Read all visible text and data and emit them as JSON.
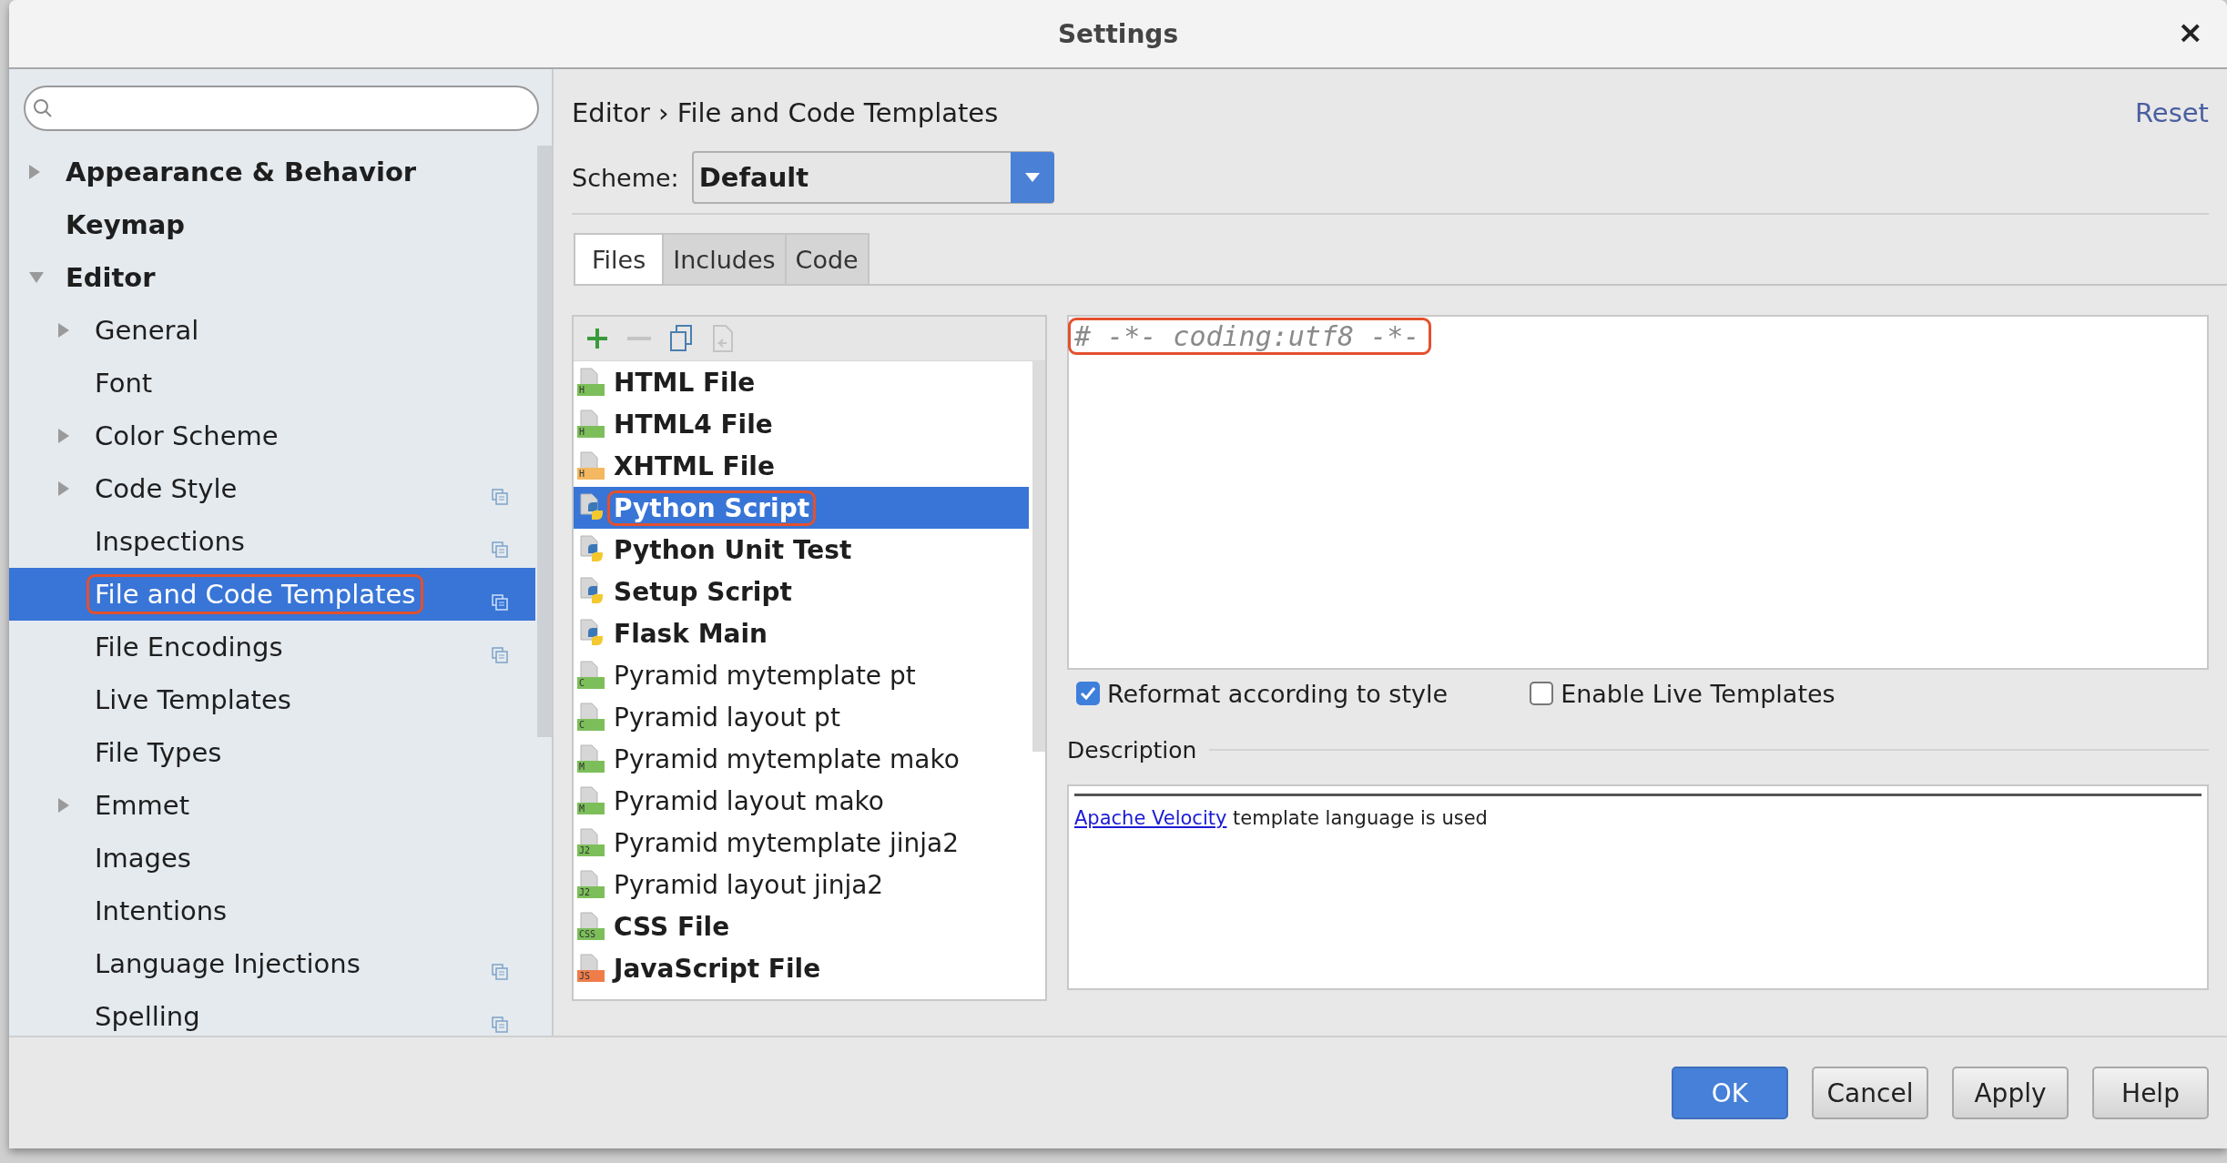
{
  "window": {
    "title": "Settings",
    "close": "×"
  },
  "sidebar": {
    "items": [
      {
        "label": "Appearance & Behavior",
        "expanded": false,
        "selected": false,
        "project_scoped": false,
        "annotated": false
      },
      {
        "label": "Keymap",
        "selected": false,
        "project_scoped": false,
        "annotated": false
      },
      {
        "label": "Editor",
        "expanded": true,
        "selected": false,
        "project_scoped": false,
        "annotated": false,
        "children": [
          {
            "label": "General",
            "expanded": false,
            "selected": false,
            "project_scoped": false,
            "annotated": false
          },
          {
            "label": "Font",
            "selected": false,
            "project_scoped": false,
            "annotated": false
          },
          {
            "label": "Color Scheme",
            "expanded": false,
            "selected": false,
            "project_scoped": false,
            "annotated": false
          },
          {
            "label": "Code Style",
            "expanded": false,
            "selected": false,
            "project_scoped": true,
            "annotated": false
          },
          {
            "label": "Inspections",
            "selected": false,
            "project_scoped": true,
            "annotated": false
          },
          {
            "label": "File and Code Templates",
            "selected": true,
            "project_scoped": true,
            "annotated": true
          },
          {
            "label": "File Encodings",
            "selected": false,
            "project_scoped": true,
            "annotated": false
          },
          {
            "label": "Live Templates",
            "selected": false,
            "project_scoped": false,
            "annotated": false
          },
          {
            "label": "File Types",
            "selected": false,
            "project_scoped": false,
            "annotated": false
          },
          {
            "label": "Emmet",
            "expanded": false,
            "selected": false,
            "project_scoped": false,
            "annotated": false
          },
          {
            "label": "Images",
            "selected": false,
            "project_scoped": false,
            "annotated": false
          },
          {
            "label": "Intentions",
            "selected": false,
            "project_scoped": false,
            "annotated": false
          },
          {
            "label": "Language Injections",
            "selected": false,
            "project_scoped": true,
            "annotated": false
          },
          {
            "label": "Spelling",
            "selected": false,
            "project_scoped": true,
            "annotated": false
          }
        ]
      }
    ]
  },
  "breadcrumb": "Editor › File and Code Templates",
  "reset_link": "Reset",
  "scheme": {
    "label": "Scheme:",
    "value": "Default"
  },
  "tabs": [
    {
      "label": "Files",
      "selected": true
    },
    {
      "label": "Includes",
      "selected": false
    },
    {
      "label": "Code",
      "selected": false
    }
  ],
  "toolbar": [
    {
      "kind": "add",
      "disabled": false
    },
    {
      "kind": "remove",
      "disabled": true
    },
    {
      "kind": "copy",
      "disabled": false
    },
    {
      "kind": "reset",
      "disabled": true
    }
  ],
  "templates": [
    {
      "name": "HTML File",
      "kind": "html",
      "badge": "H",
      "bold": true,
      "selected": false,
      "annotated": false
    },
    {
      "name": "HTML4 File",
      "kind": "html",
      "badge": "H",
      "bold": true,
      "selected": false,
      "annotated": false
    },
    {
      "name": "XHTML File",
      "kind": "xhtml",
      "badge": "H",
      "bold": true,
      "selected": false,
      "annotated": false
    },
    {
      "name": "Python Script",
      "kind": "python",
      "bold": true,
      "selected": true,
      "annotated": true
    },
    {
      "name": "Python Unit Test",
      "kind": "python",
      "bold": true,
      "selected": false,
      "annotated": false
    },
    {
      "name": "Setup Script",
      "kind": "python",
      "bold": true,
      "selected": false,
      "annotated": false
    },
    {
      "name": "Flask Main",
      "kind": "python",
      "bold": true,
      "selected": false,
      "annotated": false
    },
    {
      "name": "Pyramid mytemplate pt",
      "kind": "chameleon",
      "badge": "C",
      "bold": false,
      "selected": false,
      "annotated": false
    },
    {
      "name": "Pyramid layout pt",
      "kind": "chameleon",
      "badge": "C",
      "bold": false,
      "selected": false,
      "annotated": false
    },
    {
      "name": "Pyramid mytemplate mako",
      "kind": "mako",
      "badge": "M",
      "bold": false,
      "selected": false,
      "annotated": false
    },
    {
      "name": "Pyramid layout mako",
      "kind": "mako",
      "badge": "M",
      "bold": false,
      "selected": false,
      "annotated": false
    },
    {
      "name": "Pyramid mytemplate jinja2",
      "kind": "jinja2",
      "badge": "J2",
      "bold": false,
      "selected": false,
      "annotated": false
    },
    {
      "name": "Pyramid layout jinja2",
      "kind": "jinja2",
      "badge": "J2",
      "bold": false,
      "selected": false,
      "annotated": false
    },
    {
      "name": "CSS File",
      "kind": "css",
      "badge": "CSS",
      "bold": true,
      "selected": false,
      "annotated": false
    },
    {
      "name": "JavaScript File",
      "kind": "js",
      "badge": "JS",
      "bold": true,
      "selected": false,
      "annotated": false
    }
  ],
  "editor": {
    "text": "# -*- coding:utf8 -*-",
    "annotated": true
  },
  "options": [
    {
      "label": "Reformat according to style",
      "checked": true
    },
    {
      "label": "Enable Live Templates",
      "checked": false
    }
  ],
  "description": {
    "title": "Description",
    "link": "Apache Velocity",
    "text": "template language is used"
  },
  "buttons": [
    {
      "label": "OK",
      "default": true
    },
    {
      "label": "Cancel",
      "default": false
    },
    {
      "label": "Apply",
      "default": false
    },
    {
      "label": "Help",
      "default": false
    }
  ]
}
